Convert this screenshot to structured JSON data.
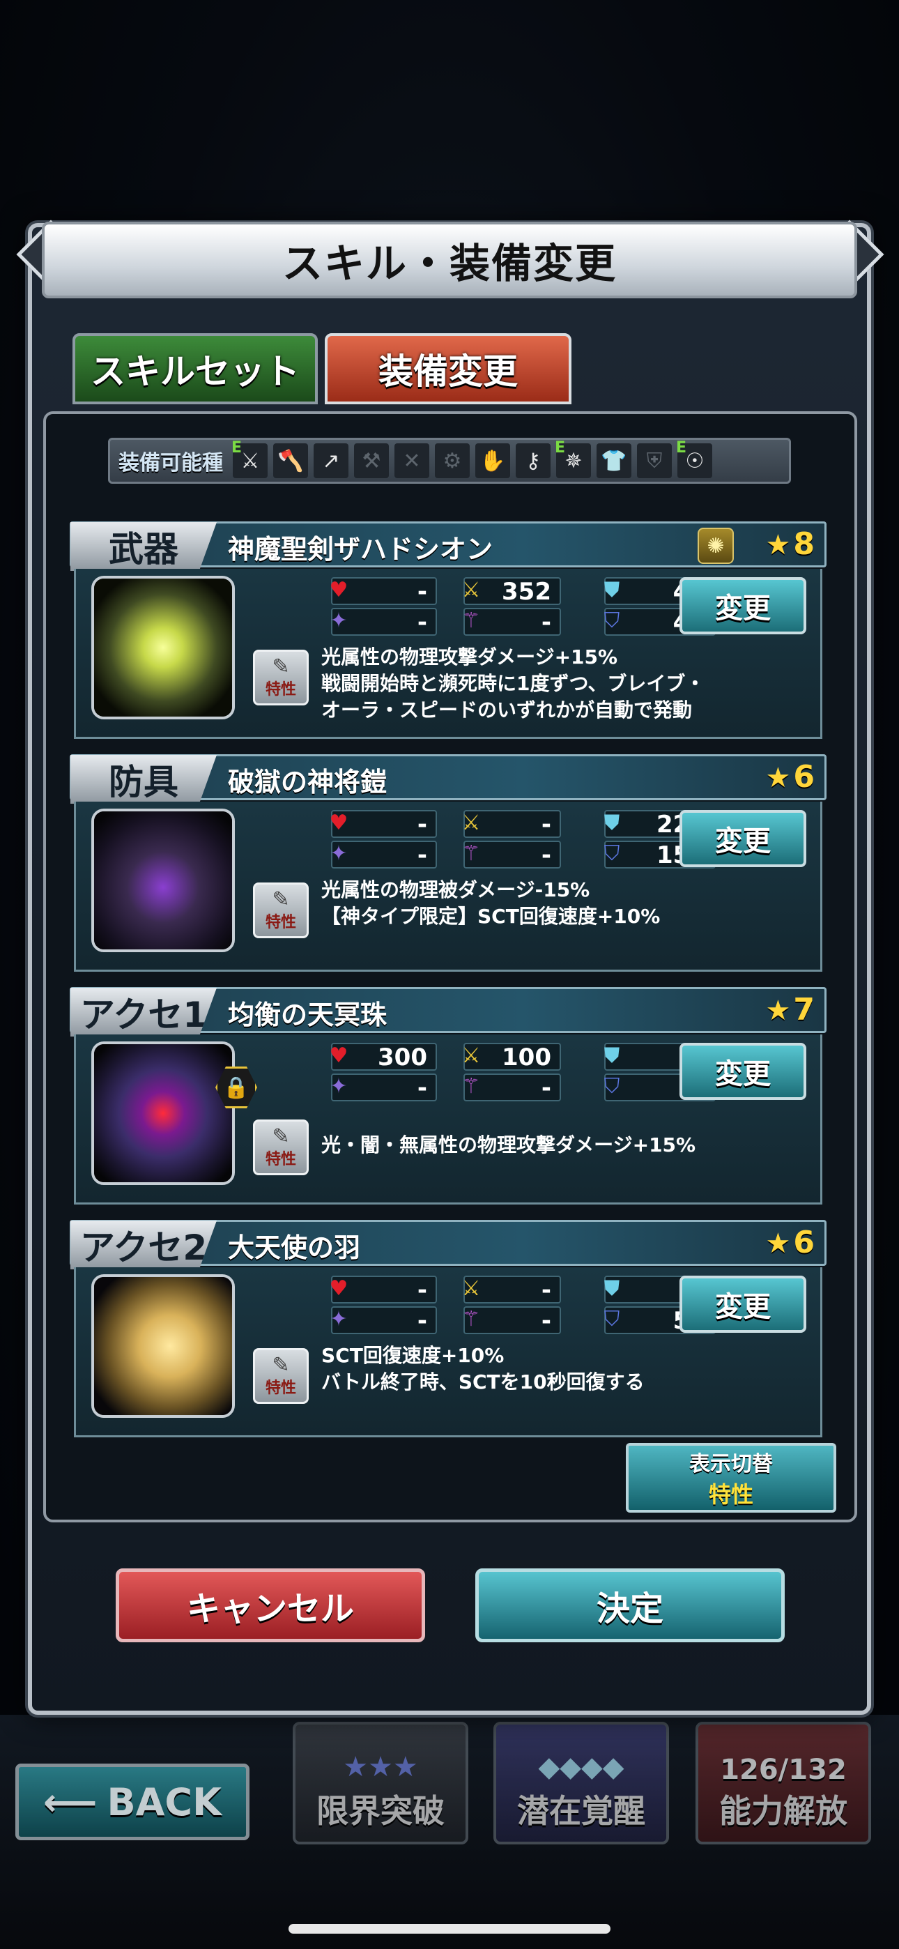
{
  "dialog": {
    "title": "スキル・装備変更"
  },
  "tabs": [
    {
      "label": "スキルセット",
      "active": false
    },
    {
      "label": "装備変更",
      "active": true
    }
  ],
  "equip_types": {
    "label": "装備可能種",
    "icons": [
      {
        "name": "sword-icon",
        "glyph": "⚔",
        "equippable": true,
        "badge": "E"
      },
      {
        "name": "axe-icon",
        "glyph": "🪓",
        "equippable": true
      },
      {
        "name": "spear-icon",
        "glyph": "↗",
        "equippable": true
      },
      {
        "name": "hammer-icon",
        "glyph": "⚒",
        "equippable": false
      },
      {
        "name": "dual-blade-icon",
        "glyph": "✕",
        "equippable": false
      },
      {
        "name": "gear-icon",
        "glyph": "⚙",
        "equippable": false
      },
      {
        "name": "gauntlet-icon",
        "glyph": "✋",
        "equippable": false
      },
      {
        "name": "staff-icon",
        "glyph": "⚷",
        "equippable": true
      },
      {
        "name": "heavy-armor-icon",
        "glyph": "✵",
        "equippable": true,
        "badge": "E"
      },
      {
        "name": "light-armor-icon",
        "glyph": "👕",
        "equippable": true
      },
      {
        "name": "robe-icon",
        "glyph": "⛨",
        "equippable": false
      },
      {
        "name": "helm-icon",
        "glyph": "☉",
        "equippable": true,
        "badge": "E"
      }
    ]
  },
  "equipment": [
    {
      "slot": "武器",
      "name": "神魔聖剣ザハドシオン",
      "rarity": "8",
      "element_icon": "light-element-icon",
      "stats": {
        "hp": "-",
        "atk": "352",
        "def": "48",
        "mp": "-",
        "mag": "-",
        "mdef": "48"
      },
      "change_label": "変更",
      "trait_badge": "特性",
      "traits": [
        "光属性の物理攻撃ダメージ+15%",
        "戦闘開始時と瀕死時に1度ずつ、ブレイブ・",
        "オーラ・スピードのいずれかが自動で発動"
      ],
      "locked": false
    },
    {
      "slot": "防具",
      "name": "破獄の神将鎧",
      "rarity": "6",
      "stats": {
        "hp": "-",
        "atk": "-",
        "def": "221",
        "mp": "-",
        "mag": "-",
        "mdef": "153"
      },
      "change_label": "変更",
      "trait_badge": "特性",
      "traits": [
        "光属性の物理被ダメージ-15%",
        "【神タイプ限定】SCT回復速度+10%"
      ],
      "locked": false
    },
    {
      "slot": "アクセ1",
      "name": "均衡の天冥珠",
      "rarity": "7",
      "stats": {
        "hp": "300",
        "atk": "100",
        "def": "-",
        "mp": "-",
        "mag": "-",
        "mdef": "-"
      },
      "change_label": "変更",
      "trait_badge": "特性",
      "traits": [
        "光・闇・無属性の物理攻撃ダメージ+15%"
      ],
      "locked": true
    },
    {
      "slot": "アクセ2",
      "name": "大天使の羽",
      "rarity": "6",
      "stats": {
        "hp": "-",
        "atk": "-",
        "def": "-",
        "mp": "-",
        "mag": "-",
        "mdef": "50"
      },
      "change_label": "変更",
      "trait_badge": "特性",
      "traits": [
        "SCT回復速度+10%",
        "バトル終了時、SCTを10秒回復する"
      ],
      "locked": false
    }
  ],
  "display_toggle": {
    "line1": "表示切替",
    "line2": "特性"
  },
  "buttons": {
    "cancel": "キャンセル",
    "confirm": "決定"
  },
  "footer": {
    "back": "BACK",
    "limit_break": "限界突破",
    "awakening": "潜在覚醒",
    "ability_release": "能力解放",
    "ability_count": "126/132"
  },
  "colors": {
    "accent_teal": "#2aa3b0",
    "cancel_red": "#c73a3f",
    "active_tab": "#c64a30",
    "skill_tab": "#2f7a2c",
    "rarity_gold": "#ffd63a"
  }
}
